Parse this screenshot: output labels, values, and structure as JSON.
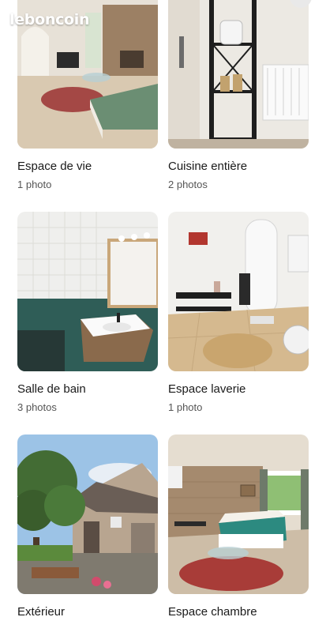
{
  "app": {
    "logo": "leboncoin"
  },
  "albums": [
    {
      "title": "Espace de vie",
      "count": "1 photo"
    },
    {
      "title": "Cuisine entière",
      "count": "2 photos"
    },
    {
      "title": "Salle de bain",
      "count": "3 photos"
    },
    {
      "title": "Espace laverie",
      "count": "1 photo"
    },
    {
      "title": "Extérieur",
      "count": ""
    },
    {
      "title": "Espace chambre",
      "count": ""
    }
  ],
  "colors": {
    "brand": "#ec5a13",
    "title": "#1a1a1a",
    "count": "#555555"
  }
}
